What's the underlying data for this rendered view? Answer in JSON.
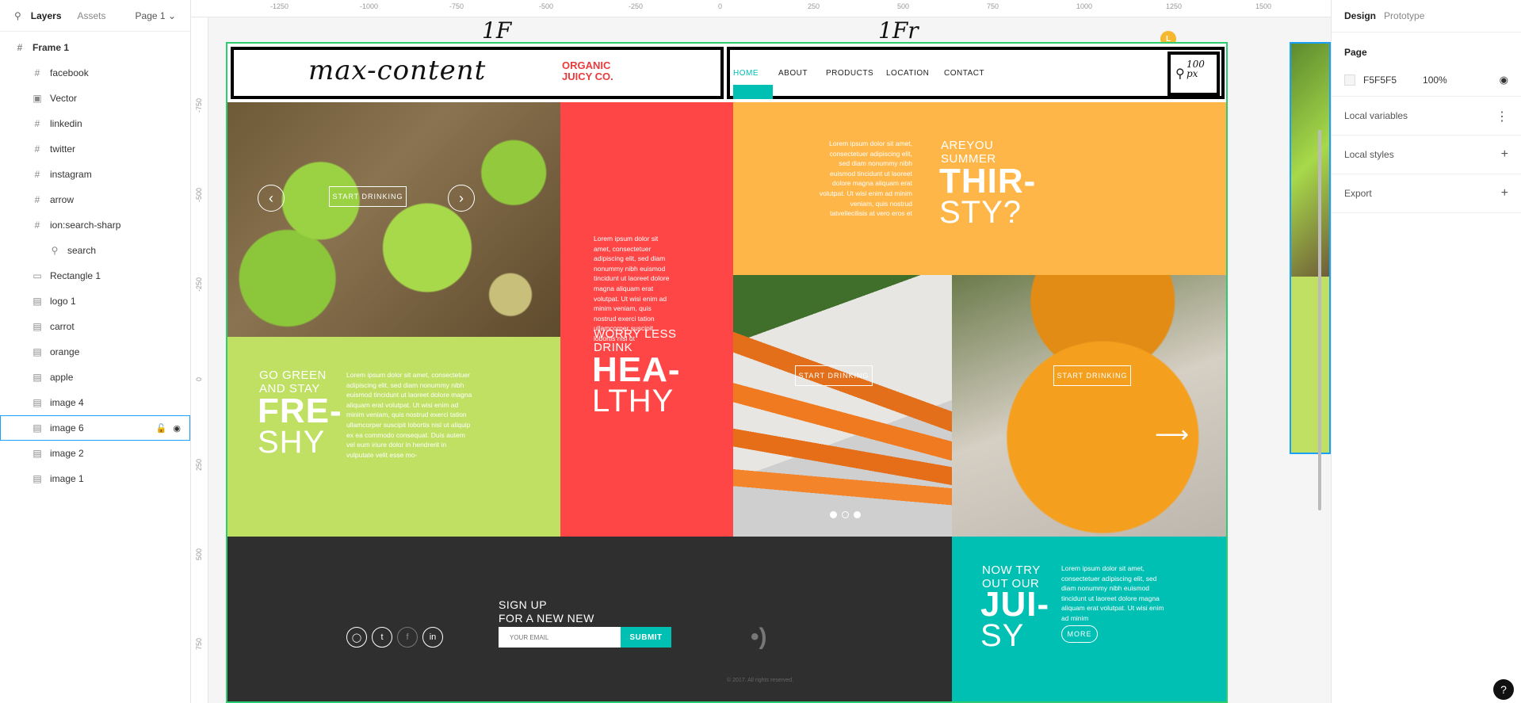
{
  "left_panel": {
    "tabs": [
      "Layers",
      "Assets"
    ],
    "page_selector": "Page 1",
    "layers": [
      {
        "label": "Frame 1",
        "icon": "frame-icon",
        "level": 0
      },
      {
        "label": "facebook",
        "icon": "frame-icon",
        "level": 1
      },
      {
        "label": "Vector",
        "icon": "vector-icon",
        "level": 1
      },
      {
        "label": "linkedin",
        "icon": "frame-icon",
        "level": 1
      },
      {
        "label": "twitter",
        "icon": "frame-icon",
        "level": 1
      },
      {
        "label": "instagram",
        "icon": "frame-icon",
        "level": 1
      },
      {
        "label": "arrow",
        "icon": "frame-icon",
        "level": 1
      },
      {
        "label": "ion:search-sharp",
        "icon": "frame-icon",
        "level": 1
      },
      {
        "label": "search",
        "icon": "search-icon",
        "level": 2
      },
      {
        "label": "Rectangle 1",
        "icon": "rectangle-icon",
        "level": 1
      },
      {
        "label": "logo 1",
        "icon": "image-icon",
        "level": 1
      },
      {
        "label": "carrot",
        "icon": "image-icon",
        "level": 1
      },
      {
        "label": "orange",
        "icon": "image-icon",
        "level": 1
      },
      {
        "label": "apple",
        "icon": "image-icon",
        "level": 1
      },
      {
        "label": "image 4",
        "icon": "image-icon",
        "level": 1
      },
      {
        "label": "image 6",
        "icon": "image-icon",
        "level": 1,
        "selected": true
      },
      {
        "label": "image 2",
        "icon": "image-icon",
        "level": 1
      },
      {
        "label": "image 1",
        "icon": "image-icon",
        "level": 1
      }
    ]
  },
  "right_panel": {
    "tabs": [
      "Design",
      "Prototype"
    ],
    "page_title": "Page",
    "page_color": "F5F5F5",
    "page_opacity": "100%",
    "sections": [
      "Local variables",
      "Local styles",
      "Export"
    ]
  },
  "rulers": {
    "top": [
      "-1250",
      "-1000",
      "-750",
      "-500",
      "-250",
      "0",
      "250",
      "500",
      "750",
      "1000",
      "1250",
      "1500"
    ],
    "left": [
      "-750",
      "-500",
      "-250",
      "0",
      "250",
      "500",
      "750"
    ]
  },
  "canvas": {
    "cursor_label": "L",
    "scribbles": [
      "1F",
      "1Fr",
      "max-content"
    ],
    "header": {
      "brand_line1": "ORGANIC",
      "brand_line2": "JUICY CO.",
      "nav": [
        "HOME",
        "ABOUT",
        "PRODUCTS",
        "LOCATION",
        "CONTACT"
      ],
      "search_scribble": "100 px"
    },
    "apple_tile": {
      "button": "START DRINKING"
    },
    "green_tile": {
      "small_head_1": "GO GREEN",
      "small_head_2": "AND STAY",
      "big_1": "FRE-",
      "big_2": "SHY",
      "body": "Lorem ipsum dolor sit amet, consectetuer adipiscing elit, sed diam nonummy nibh euismod tincidunt ut laoreet dolore magna aliquam erat volutpat. Ut wisi enim ad minim veniam, quis nostrud exerci tation ullamcorper suscipit lobortis nisl ut aliquip ex ea commodo consequat. Duis autem vel eum iriure dolor in hendrerit in vulputate velit esse mo-"
    },
    "red_tile": {
      "body": "Lorem ipsum dolor sit amet, consectetuer adipiscing elit, sed diam nonummy nibh euismod tincidunt ut laoreet dolore magna aliquam erat volutpat. Ut wisi enim ad minim veniam, quis nostrud exerci tation ullamcorper suscipit lobortis nisl ut",
      "small_head_1": "WORRY LESS",
      "small_head_2": "DRINK",
      "big_1": "HEA-",
      "big_2": "LTHY"
    },
    "orange_tile": {
      "body": "Lorem ipsum dolor sit amet, consectetuer adipiscing elit, sed diam nonummy nibh euismod tincidunt ut laoreet dolore magna aliquam erat volutpat. Ut wisi enim ad minim veniam, quis nostrud tatvellecilisis at vero eros et",
      "small_head_1": "AREYOU",
      "small_head_2": "SUMMER",
      "big_1": "THIR-",
      "big_2": "STY?"
    },
    "carrot_tile": {
      "button": "START DRINKING"
    },
    "mandarin_tile": {
      "button": "START DRINKING"
    },
    "footer": {
      "signup_1": "SIGN UP",
      "signup_2": "FOR A NEW NEW",
      "email_placeholder": "YOUR EMAIL",
      "submit": "SUBMIT",
      "copyright": "© 2017. All rights reserved."
    },
    "teal_tile": {
      "small_head_1": "NOW TRY",
      "small_head_2": "OUT OUR",
      "big_1": "JUI-",
      "big_2": "SY",
      "body": "Lorem ipsum dolor sit amet, consectetuer adipiscing elit, sed diam nonummy nibh euismod tincidunt ut laoreet dolore magna aliquam erat volutpat. Ut wisi enim ad minim",
      "button": "MORE"
    }
  },
  "colors": {
    "accent_teal": "#00bfb3",
    "red": "#ff4646",
    "orange": "#ffb648",
    "green": "#bfe063",
    "dark": "#2f2f2f",
    "selection": "#18a0fb",
    "frame_outline": "#2ecc71"
  }
}
